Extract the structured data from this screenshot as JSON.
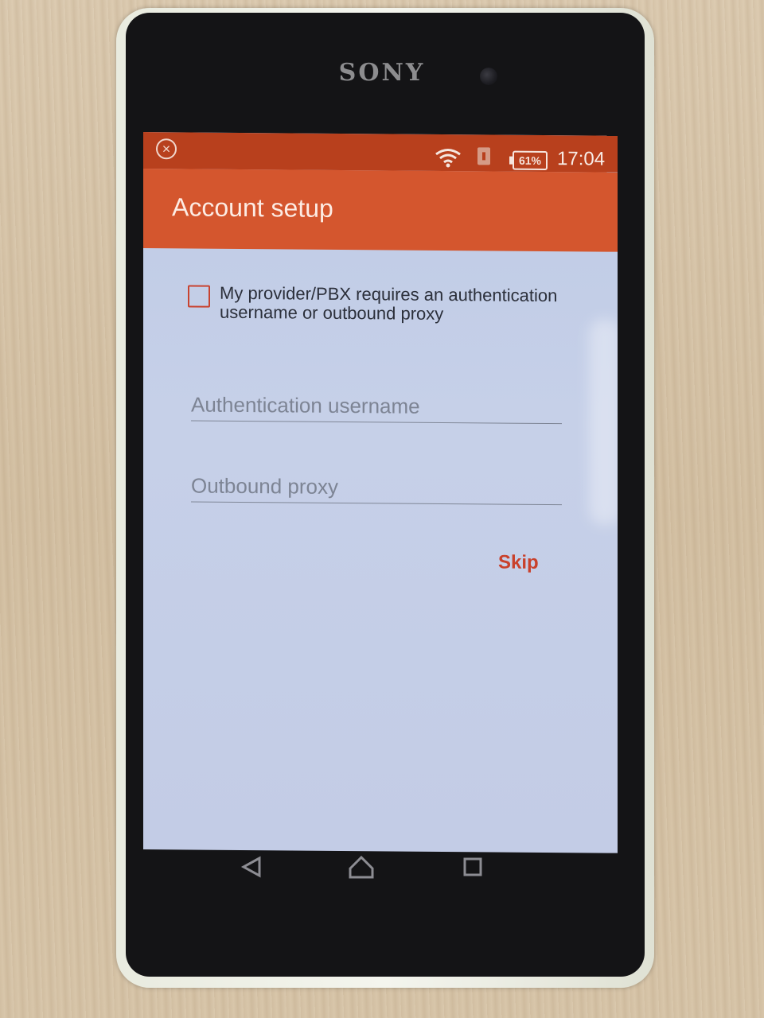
{
  "device": {
    "brand": "SONY"
  },
  "status_bar": {
    "notification_icon": "close-circle-icon",
    "wifi_icon": "wifi-icon",
    "sim_icon": "sim-card-alert-icon",
    "battery_percent": "61%",
    "battery_level": 0.61,
    "time": "17:04",
    "color": "#b8401d"
  },
  "app_bar": {
    "title": "Account setup",
    "color": "#d4562e"
  },
  "form": {
    "checkbox": {
      "label": "My provider/PBX requires an authentication username or outbound proxy",
      "checked": false
    },
    "auth_username": {
      "placeholder": "Authentication username",
      "value": ""
    },
    "outbound_proxy": {
      "placeholder": "Outbound proxy",
      "value": ""
    },
    "skip_label": "Skip",
    "accent_color": "#c9402b"
  },
  "navigation_bar": {
    "back_icon": "back-triangle-icon",
    "home_icon": "home-icon",
    "recents_icon": "recents-square-icon"
  }
}
